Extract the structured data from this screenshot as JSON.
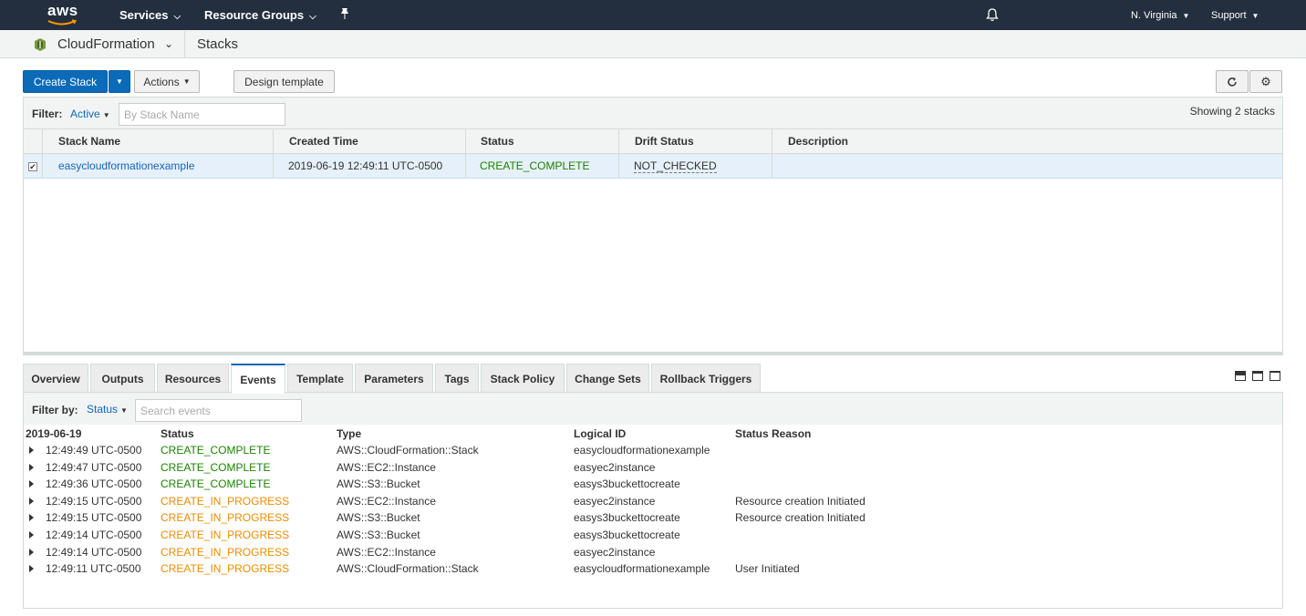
{
  "topnav": {
    "logo": "aws",
    "services": "Services",
    "resource_groups": "Resource Groups",
    "region": "N. Virginia",
    "support": "Support"
  },
  "service_bar": {
    "service": "CloudFormation",
    "breadcrumb": "Stacks"
  },
  "toolbar": {
    "create_stack": "Create Stack",
    "actions": "Actions",
    "design_template": "Design template"
  },
  "stack_filter": {
    "label": "Filter:",
    "value": "Active",
    "placeholder": "By Stack Name",
    "showing": "Showing 2 stacks"
  },
  "stack_table": {
    "headers": [
      "Stack Name",
      "Created Time",
      "Status",
      "Drift Status",
      "Description"
    ],
    "rows": [
      {
        "name": "easycloudformationexample",
        "created": "2019-06-19 12:49:11 UTC-0500",
        "status": "CREATE_COMPLETE",
        "drift": "NOT_CHECKED",
        "description": ""
      }
    ]
  },
  "tabs": [
    "Overview",
    "Outputs",
    "Resources",
    "Events",
    "Template",
    "Parameters",
    "Tags",
    "Stack Policy",
    "Change Sets",
    "Rollback Triggers"
  ],
  "active_tab": "Events",
  "events_filter": {
    "label": "Filter by:",
    "value": "Status",
    "placeholder": "Search events"
  },
  "events": {
    "date": "2019-06-19",
    "headers": {
      "status": "Status",
      "type": "Type",
      "logical_id": "Logical ID",
      "reason": "Status Reason"
    },
    "rows": [
      {
        "time": "12:49:49 UTC-0500",
        "status": "CREATE_COMPLETE",
        "type": "AWS::CloudFormation::Stack",
        "logical_id": "easycloudformationexample",
        "reason": ""
      },
      {
        "time": "12:49:47 UTC-0500",
        "status": "CREATE_COMPLETE",
        "type": "AWS::EC2::Instance",
        "logical_id": "easyec2instance",
        "reason": ""
      },
      {
        "time": "12:49:36 UTC-0500",
        "status": "CREATE_COMPLETE",
        "type": "AWS::S3::Bucket",
        "logical_id": "easys3buckettocreate",
        "reason": ""
      },
      {
        "time": "12:49:15 UTC-0500",
        "status": "CREATE_IN_PROGRESS",
        "type": "AWS::EC2::Instance",
        "logical_id": "easyec2instance",
        "reason": "Resource creation Initiated"
      },
      {
        "time": "12:49:15 UTC-0500",
        "status": "CREATE_IN_PROGRESS",
        "type": "AWS::S3::Bucket",
        "logical_id": "easys3buckettocreate",
        "reason": "Resource creation Initiated"
      },
      {
        "time": "12:49:14 UTC-0500",
        "status": "CREATE_IN_PROGRESS",
        "type": "AWS::S3::Bucket",
        "logical_id": "easys3buckettocreate",
        "reason": ""
      },
      {
        "time": "12:49:14 UTC-0500",
        "status": "CREATE_IN_PROGRESS",
        "type": "AWS::EC2::Instance",
        "logical_id": "easyec2instance",
        "reason": ""
      },
      {
        "time": "12:49:11 UTC-0500",
        "status": "CREATE_IN_PROGRESS",
        "type": "AWS::CloudFormation::Stack",
        "logical_id": "easycloudformationexample",
        "reason": "User Initiated"
      }
    ]
  },
  "colors": {
    "nav_bg": "#232f3e",
    "primary": "#0c6bb8",
    "link": "#1166bb",
    "complete": "#1d8102",
    "in_progress": "#eb8c00"
  }
}
